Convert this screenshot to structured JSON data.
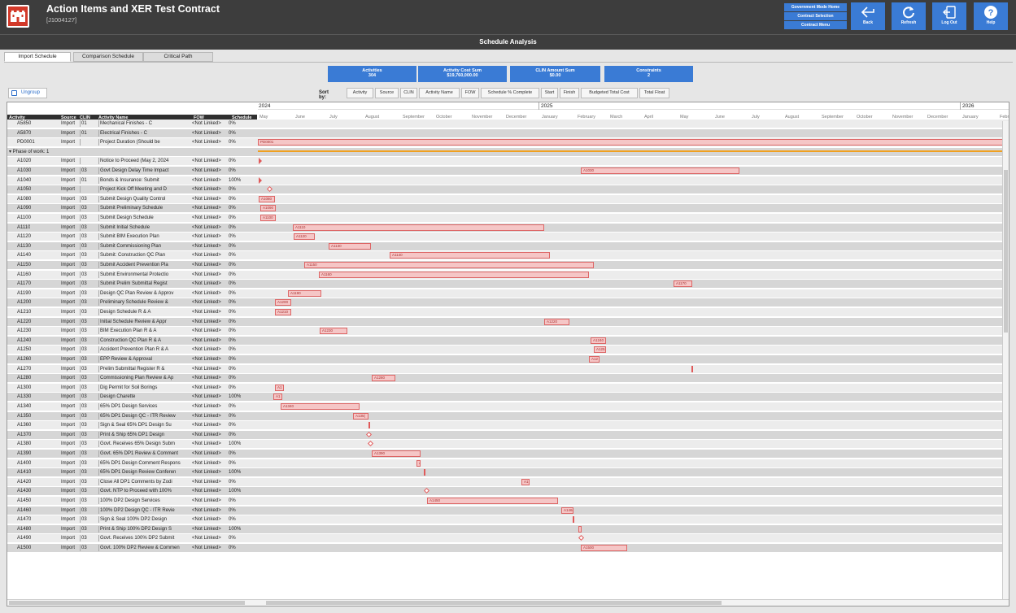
{
  "app": {
    "title": "Action Items and XER Test Contract",
    "subtitle": "[J1004127]",
    "page_title": "Schedule Analysis"
  },
  "gov_menu": [
    "Government Mode Home",
    "Contract Selection",
    "Contract Menu"
  ],
  "header_buttons": [
    {
      "label": "Back",
      "icon": "back-arrow-icon"
    },
    {
      "label": "Refresh",
      "icon": "refresh-icon"
    },
    {
      "label": "Log Out",
      "icon": "logout-icon"
    },
    {
      "label": "Help",
      "icon": "help-icon"
    }
  ],
  "tabs": [
    {
      "label": "Import Schedule",
      "active": true
    },
    {
      "label": "Comparison Schedule",
      "active": false
    },
    {
      "label": "Critical Path",
      "active": false
    }
  ],
  "summary": [
    {
      "label": "Activities",
      "value": "304"
    },
    {
      "label": "Activity Cost Sum",
      "value": "$19,760,000.00"
    },
    {
      "label": "CLIN Amount Sum",
      "value": "$0.00"
    },
    {
      "label": "Constraints",
      "value": "2"
    }
  ],
  "ungroup_label": "Ungroup",
  "sort": {
    "label": "Sort by:",
    "options": [
      "Activity",
      "Source",
      "CLIN",
      "Activity Name",
      "FOW",
      "Schedule % Complete",
      "Start",
      "Finish",
      "Budgeted Total Cost",
      "Total Float"
    ]
  },
  "columns": [
    "Activity",
    "Source",
    "CLIN",
    "Activity Name",
    "FOW",
    "Schedule"
  ],
  "years": [
    "2024",
    "2025",
    "2026"
  ],
  "months": [
    "May",
    "June",
    "July",
    "August",
    "September",
    "October",
    "November",
    "December",
    "January",
    "February",
    "March",
    "April",
    "May",
    "June",
    "July",
    "August",
    "September",
    "October",
    "November",
    "December",
    "January",
    "Febr"
  ],
  "phase_label": "Phase of work: 1",
  "rows": [
    {
      "act": "A5850",
      "src": "Import",
      "clin": "01",
      "name": "Mechanical Finishes - C",
      "fow": "<Not Linked>",
      "pct": "0%",
      "g": null
    },
    {
      "act": "A5870",
      "src": "Import",
      "clin": "01",
      "name": "Electrical Finishes - C",
      "fow": "<Not Linked>",
      "pct": "0%",
      "g": null
    },
    {
      "act": "PD0001",
      "src": "Import",
      "clin": "",
      "name": "Project Duration  (Should be",
      "fow": "<Not Linked>",
      "pct": "0%",
      "g": {
        "t": "bar",
        "s": 0,
        "e": 925,
        "l": "PD0001"
      }
    },
    {
      "act": "PHASE"
    },
    {
      "act": "A1020",
      "src": "Import",
      "clin": "",
      "name": "Notice to Proceed (May 2, 2024",
      "fow": "<Not Linked>",
      "pct": "0%",
      "g": {
        "t": "tri",
        "s": 1
      }
    },
    {
      "act": "A1030",
      "src": "Import",
      "clin": "03",
      "name": "Govt Design Delay Time Impact",
      "fow": "<Not Linked>",
      "pct": "0%",
      "g": {
        "t": "bar",
        "s": 397,
        "e": 592,
        "l": "A1030"
      }
    },
    {
      "act": "A1040",
      "src": "Import",
      "clin": "01",
      "name": "Bonds & Insurance: Submit",
      "fow": "<Not Linked>",
      "pct": "100%",
      "g": {
        "t": "tri",
        "s": 1
      }
    },
    {
      "act": "A1050",
      "src": "Import",
      "clin": "",
      "name": "Project Kick Off Meeting and D",
      "fow": "<Not Linked>",
      "pct": "0%",
      "g": {
        "t": "dia",
        "s": 12
      }
    },
    {
      "act": "A1080",
      "src": "Import",
      "clin": "03",
      "name": "Submit Design Quality Control",
      "fow": "<Not Linked>",
      "pct": "0%",
      "g": {
        "t": "bar",
        "s": 1,
        "e": 21,
        "l": "A1080"
      }
    },
    {
      "act": "A1090",
      "src": "Import",
      "clin": "03",
      "name": "Submit Preliminary Schedule",
      "fow": "<Not Linked>",
      "pct": "0%",
      "g": {
        "t": "bar",
        "s": 3,
        "e": 22,
        "l": "A1090"
      }
    },
    {
      "act": "A1100",
      "src": "Import",
      "clin": "03",
      "name": "Submit Design Schedule",
      "fow": "<Not Linked>",
      "pct": "0%",
      "g": {
        "t": "bar",
        "s": 3,
        "e": 22,
        "l": "A1100"
      }
    },
    {
      "act": "A1110",
      "src": "Import",
      "clin": "03",
      "name": "Submit Initial Schedule",
      "fow": "<Not Linked>",
      "pct": "0%",
      "g": {
        "t": "bar",
        "s": 43,
        "e": 352,
        "l": "A1110"
      }
    },
    {
      "act": "A1120",
      "src": "Import",
      "clin": "03",
      "name": "Submit BIM Execution Plan",
      "fow": "<Not Linked>",
      "pct": "0%",
      "g": {
        "t": "bar",
        "s": 44,
        "e": 70,
        "l": "A1120"
      }
    },
    {
      "act": "A1130",
      "src": "Import",
      "clin": "03",
      "name": "Submit Commissioning Plan",
      "fow": "<Not Linked>",
      "pct": "0%",
      "g": {
        "t": "bar",
        "s": 87,
        "e": 139,
        "l": "A1130"
      }
    },
    {
      "act": "A1140",
      "src": "Import",
      "clin": "03",
      "name": "Submit:  Construction QC Plan",
      "fow": "<Not Linked>",
      "pct": "0%",
      "g": {
        "t": "bar",
        "s": 162,
        "e": 359,
        "l": "A1140"
      }
    },
    {
      "act": "A1150",
      "src": "Import",
      "clin": "03",
      "name": "Submit Accident Prevention Pla",
      "fow": "<Not Linked>",
      "pct": "0%",
      "g": {
        "t": "bar",
        "s": 57,
        "e": 413,
        "l": "A1150"
      }
    },
    {
      "act": "A1160",
      "src": "Import",
      "clin": "03",
      "name": "Submit Environmental Protectio",
      "fow": "<Not Linked>",
      "pct": "0%",
      "g": {
        "t": "bar",
        "s": 75,
        "e": 407,
        "l": "A1160"
      }
    },
    {
      "act": "A1170",
      "src": "Import",
      "clin": "03",
      "name": "Submit Prelim Submittal Regist",
      "fow": "<Not Linked>",
      "pct": "0%",
      "g": {
        "t": "bar",
        "s": 511,
        "e": 534,
        "l": "A1170"
      }
    },
    {
      "act": "A1190",
      "src": "Import",
      "clin": "03",
      "name": "Design QC Plan Review & Approv",
      "fow": "<Not Linked>",
      "pct": "0%",
      "g": {
        "t": "bar",
        "s": 37,
        "e": 78,
        "l": "A1190"
      }
    },
    {
      "act": "A1200",
      "src": "Import",
      "clin": "03",
      "name": "Preliminary Schedule Review &",
      "fow": "<Not Linked>",
      "pct": "0%",
      "g": {
        "t": "bar",
        "s": 21,
        "e": 41,
        "l": "A1200"
      }
    },
    {
      "act": "A1210",
      "src": "Import",
      "clin": "03",
      "name": "Design Schedule R & A",
      "fow": "<Not Linked>",
      "pct": "0%",
      "g": {
        "t": "bar",
        "s": 21,
        "e": 41,
        "l": "A1210"
      }
    },
    {
      "act": "A1220",
      "src": "Import",
      "clin": "03",
      "name": "Initial Schedule Review & Appr",
      "fow": "<Not Linked>",
      "pct": "0%",
      "g": {
        "t": "bar",
        "s": 352,
        "e": 383,
        "l": "A1220"
      }
    },
    {
      "act": "A1230",
      "src": "Import",
      "clin": "03",
      "name": "BIM Execution Plan R & A",
      "fow": "<Not Linked>",
      "pct": "0%",
      "g": {
        "t": "bar",
        "s": 76,
        "e": 110,
        "l": "A1230"
      }
    },
    {
      "act": "A1240",
      "src": "Import",
      "clin": "03",
      "name": "Construction QC Plan R & A",
      "fow": "<Not Linked>",
      "pct": "0%",
      "g": {
        "t": "bar",
        "s": 409,
        "e": 428,
        "l": "A1240"
      }
    },
    {
      "act": "A1250",
      "src": "Import",
      "clin": "03",
      "name": "Accident Prevention Plan R & A",
      "fow": "<Not Linked>",
      "pct": "0%",
      "g": {
        "t": "bar",
        "s": 413,
        "e": 428,
        "l": "A125"
      }
    },
    {
      "act": "A1260",
      "src": "Import",
      "clin": "03",
      "name": "EPP Review & Approval",
      "fow": "<Not Linked>",
      "pct": "0%",
      "g": {
        "t": "bar",
        "s": 407,
        "e": 420,
        "l": "A12"
      }
    },
    {
      "act": "A1270",
      "src": "Import",
      "clin": "03",
      "name": "Prelim Submittal Register R &",
      "fow": "<Not Linked>",
      "pct": "0%",
      "g": {
        "t": "tick",
        "s": 533
      }
    },
    {
      "act": "A1280",
      "src": "Import",
      "clin": "03",
      "name": "Commissioning Plan Review & Ap",
      "fow": "<Not Linked>",
      "pct": "0%",
      "g": {
        "t": "bar",
        "s": 140,
        "e": 169,
        "l": "A1280"
      }
    },
    {
      "act": "A1300",
      "src": "Import",
      "clin": "03",
      "name": "Dig Permit for Soil Borings",
      "fow": "<Not Linked>",
      "pct": "0%",
      "g": {
        "t": "bar",
        "s": 21,
        "e": 32,
        "l": "A1"
      }
    },
    {
      "act": "A1330",
      "src": "Import",
      "clin": "03",
      "name": "Design Charette",
      "fow": "<Not Linked>",
      "pct": "100%",
      "g": {
        "t": "bar",
        "s": 19,
        "e": 30,
        "l": "A1"
      }
    },
    {
      "act": "A1340",
      "src": "Import",
      "clin": "03",
      "name": "65% DP1 Design Services",
      "fow": "<Not Linked>",
      "pct": "0%",
      "g": {
        "t": "bar",
        "s": 28,
        "e": 125,
        "l": "A1340"
      }
    },
    {
      "act": "A1350",
      "src": "Import",
      "clin": "03",
      "name": "65% DP1 Design QC - ITR Review",
      "fow": "<Not Linked>",
      "pct": "0%",
      "g": {
        "t": "bar",
        "s": 117,
        "e": 136,
        "l": "A135("
      }
    },
    {
      "act": "A1360",
      "src": "Import",
      "clin": "03",
      "name": "Sign & Seal 65% DP1  Design Su",
      "fow": "<Not Linked>",
      "pct": "0%",
      "g": {
        "t": "tick",
        "s": 136
      }
    },
    {
      "act": "A1370",
      "src": "Import",
      "clin": "03",
      "name": "Print & Ship 65% DP1 Design",
      "fow": "<Not Linked>",
      "pct": "0%",
      "g": {
        "t": "dia",
        "s": 134
      }
    },
    {
      "act": "A1380",
      "src": "Import",
      "clin": "03",
      "name": "Govt. Receives 65% Design Subm",
      "fow": "<Not Linked>",
      "pct": "100%",
      "g": {
        "t": "dia",
        "s": 136
      }
    },
    {
      "act": "A1390",
      "src": "Import",
      "clin": "03",
      "name": "Govt. 65% DP1 Review & Comment",
      "fow": "<Not Linked>",
      "pct": "0%",
      "g": {
        "t": "bar",
        "s": 140,
        "e": 200,
        "l": "A1390"
      }
    },
    {
      "act": "A1400",
      "src": "Import",
      "clin": "03",
      "name": "65% DP1 Design Comment Respons",
      "fow": "<Not Linked>",
      "pct": "0%",
      "g": {
        "t": "bar",
        "s": 195,
        "e": 200,
        "l": "A"
      }
    },
    {
      "act": "A1410",
      "src": "Import",
      "clin": "03",
      "name": "65% DP1 Design Review Conferen",
      "fow": "<Not Linked>",
      "pct": "100%",
      "g": {
        "t": "tick",
        "s": 204
      }
    },
    {
      "act": "A1420",
      "src": "Import",
      "clin": "03",
      "name": "Close All DP1 Comments by Zodi",
      "fow": "<Not Linked>",
      "pct": "0%",
      "g": {
        "t": "bar",
        "s": 324,
        "e": 334,
        "l": "A1"
      }
    },
    {
      "act": "A1430",
      "src": "Import",
      "clin": "03",
      "name": "Govt. NTP to Proceed with 100%",
      "fow": "<Not Linked>",
      "pct": "100%",
      "g": {
        "t": "dia",
        "s": 205
      }
    },
    {
      "act": "A1450",
      "src": "Import",
      "clin": "03",
      "name": "100% DP2 Design Services",
      "fow": "<Not Linked>",
      "pct": "0%",
      "g": {
        "t": "bar",
        "s": 208,
        "e": 369,
        "l": "A1450"
      }
    },
    {
      "act": "A1460",
      "src": "Import",
      "clin": "03",
      "name": "100% DP2 Design QC - ITR Revie",
      "fow": "<Not Linked>",
      "pct": "0%",
      "g": {
        "t": "bar",
        "s": 373,
        "e": 388,
        "l": "A146("
      }
    },
    {
      "act": "A1470",
      "src": "Import",
      "clin": "03",
      "name": "Sign & Seal 100% DP2 Design",
      "fow": "<Not Linked>",
      "pct": "0%",
      "g": {
        "t": "tick",
        "s": 387
      }
    },
    {
      "act": "A1480",
      "src": "Import",
      "clin": "03",
      "name": "Print & Ship 100% DP2 Design S",
      "fow": "<Not Linked>",
      "pct": "100%",
      "g": {
        "t": "bar",
        "s": 394,
        "e": 398,
        "l": ""
      }
    },
    {
      "act": "A1490",
      "src": "Import",
      "clin": "03",
      "name": "Govt. Receives 100% DP2 Submit",
      "fow": "<Not Linked>",
      "pct": "0%",
      "g": {
        "t": "dia",
        "s": 395
      }
    },
    {
      "act": "A1500",
      "src": "Import",
      "clin": "03",
      "name": "Govt. 100% DP2 Review & Commen",
      "fow": "<Not Linked>",
      "pct": "0%",
      "g": {
        "t": "bar",
        "s": 397,
        "e": 454,
        "l": "A1500"
      }
    }
  ]
}
